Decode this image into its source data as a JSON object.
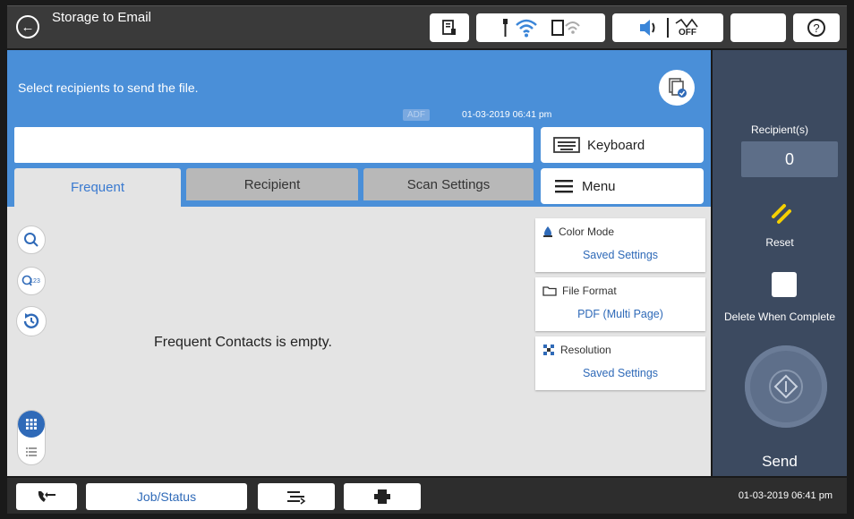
{
  "header": {
    "title": "Storage to Email",
    "status_icons": [
      "printer-status-icon",
      "wifi-icon",
      "wifi-direct-icon",
      "sound-icon",
      "network-off-icon",
      "sleep-icon",
      "help-icon"
    ],
    "network_off_label": "OFF"
  },
  "main": {
    "instruction": "Select recipients to send the file.",
    "adf_label": "ADF",
    "datetime": "01-03-2019 06:41 pm",
    "search_value": "",
    "keyboard_label": "Keyboard",
    "menu_label": "Menu",
    "tabs": [
      {
        "label": "Frequent",
        "active": true
      },
      {
        "label": "Recipient",
        "active": false
      },
      {
        "label": "Scan Settings",
        "active": false
      }
    ],
    "empty_message": "Frequent Contacts is empty.",
    "settings": [
      {
        "label": "Color Mode",
        "value": "Saved Settings",
        "icon": "color-mode-icon"
      },
      {
        "label": "File Format",
        "value": "PDF (Multi Page)",
        "icon": "folder-icon"
      },
      {
        "label": "Resolution",
        "value": "Saved Settings",
        "icon": "resolution-icon"
      }
    ]
  },
  "right": {
    "recipients_label": "Recipient(s)",
    "recipients_count": "0",
    "reset_label": "Reset",
    "delete_label": "Delete When Complete",
    "delete_checked": false,
    "send_label": "Send"
  },
  "footer": {
    "job_status_label": "Job/Status",
    "datetime": "01-03-2019 06:41 pm"
  },
  "colors": {
    "header_blue": "#4a8fd8",
    "accent_blue": "#2f6ab8",
    "right_panel": "#3c4a60",
    "reset_yellow": "#f5d000"
  }
}
